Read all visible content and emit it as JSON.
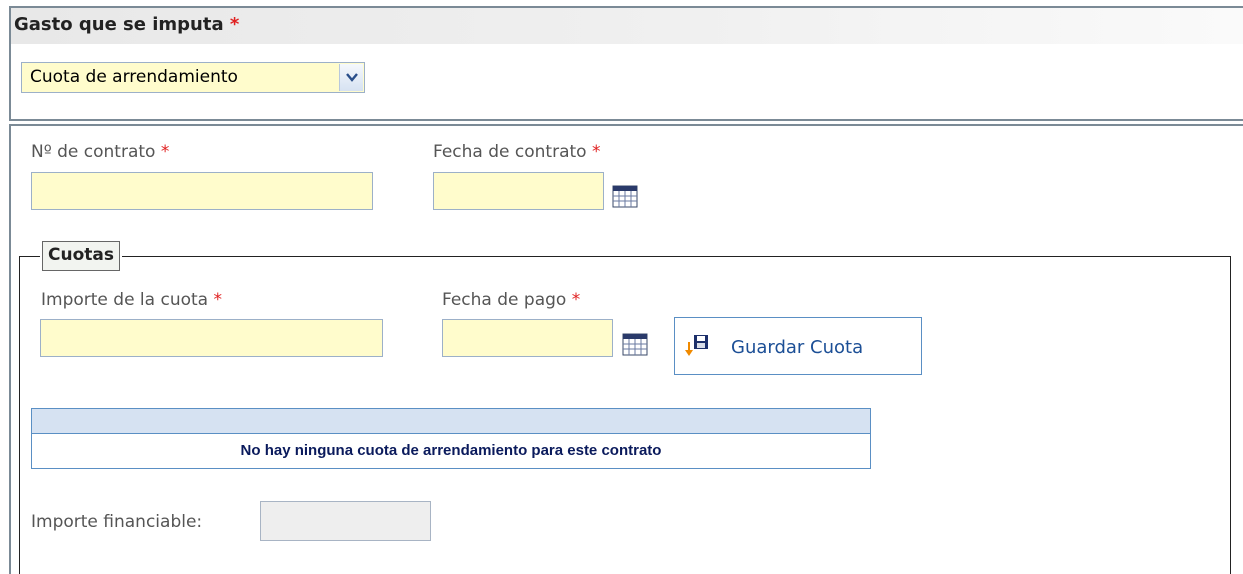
{
  "gasto": {
    "title": "Gasto que se imputa",
    "required_mark": "*",
    "select_value": "Cuota de arrendamiento"
  },
  "contrato": {
    "numero_label": "Nº de contrato",
    "numero_value": "",
    "fecha_label": "Fecha de contrato",
    "fecha_value": "",
    "required_mark": "*"
  },
  "cuotas": {
    "legend": "Cuotas",
    "importe_label": "Importe de la cuota",
    "importe_value": "",
    "fecha_pago_label": "Fecha de pago",
    "fecha_pago_value": "",
    "required_mark": "*",
    "save_button_label": "Guardar Cuota",
    "empty_message": "No hay ninguna cuota de arrendamiento para este contrato"
  },
  "financiable": {
    "label": "Importe financiable:",
    "value": ""
  },
  "icons": {
    "calendar": "calendar-icon",
    "save": "save-icon",
    "dropdown": "chevron-down-icon"
  },
  "colors": {
    "input_background": "#fffccc",
    "required": "#e02020",
    "accent_border": "#5a8fc4",
    "button_text": "#1c4f96",
    "table_header": "#d6e2f2"
  }
}
